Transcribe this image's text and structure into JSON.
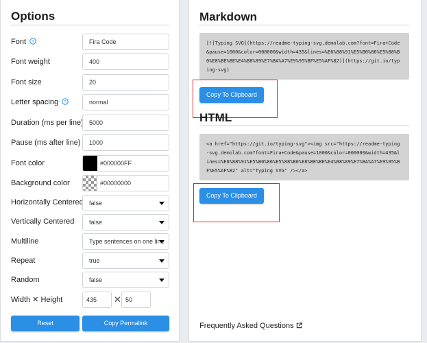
{
  "options": {
    "title": "Options",
    "fields": {
      "font": {
        "label": "Font",
        "value": "Fira Code"
      },
      "font_weight": {
        "label": "Font weight",
        "value": "400"
      },
      "font_size": {
        "label": "Font size",
        "value": "20"
      },
      "letter_spacing": {
        "label": "Letter spacing",
        "value": "normal"
      },
      "duration": {
        "label": "Duration (ms per line)",
        "value": "5000"
      },
      "pause": {
        "label": "Pause (ms after line)",
        "value": "1000"
      },
      "font_color": {
        "label": "Font color",
        "value": "#000000FF",
        "swatch_color": "#000000"
      },
      "background_color": {
        "label": "Background color",
        "value": "#00000000"
      },
      "horizontally_centered": {
        "label": "Horizontally Centered",
        "value": "false"
      },
      "vertically_centered": {
        "label": "Vertically Centered",
        "value": "false"
      },
      "multiline": {
        "label": "Multiline",
        "value": "Type sentences on one line"
      },
      "repeat": {
        "label": "Repeat",
        "value": "true"
      },
      "random": {
        "label": "Random",
        "value": "false"
      },
      "size": {
        "label": "Width ✕ Height",
        "width": "435",
        "times": "✕",
        "height": "50"
      }
    },
    "reset_label": "Reset",
    "permalink_label": "Copy Permalink"
  },
  "markdown": {
    "title": "Markdown",
    "code": "[![Typing SVG](https://readme-typing-svg.demolab.com?font=Fira+Code&pause=1000&color=000000&width=435&lines=%E6%88%91%E5%B0%86%E5%88%B0%E8%BE%BE%E4%B8%89%E7%BA%A7%E9%95%BF%E5%AF%82)](https://git.io/typing-svg)",
    "copy_label": "Copy To Clipboard"
  },
  "html": {
    "title": "HTML",
    "code": "<a href=\"https://git.io/typing-svg\"><img src=\"https://readme-typing-svg.demolab.com?font=Fira+Code&pause=1000&color=000000&width=435&lines=%E6%88%91%E5%B0%86%E5%88%B0%E8%BE%BE%E4%B8%89%E7%BA%A7%E9%95%BF%E5%AF%82\" alt=\"Typing SVG\" /></a>",
    "copy_label": "Copy To Clipboard"
  },
  "faq_label": "Frequently Asked Questions",
  "colors": {
    "accent": "#2b8fe6",
    "highlight_box": "#e0262b",
    "code_bg": "#d3d3d3"
  }
}
